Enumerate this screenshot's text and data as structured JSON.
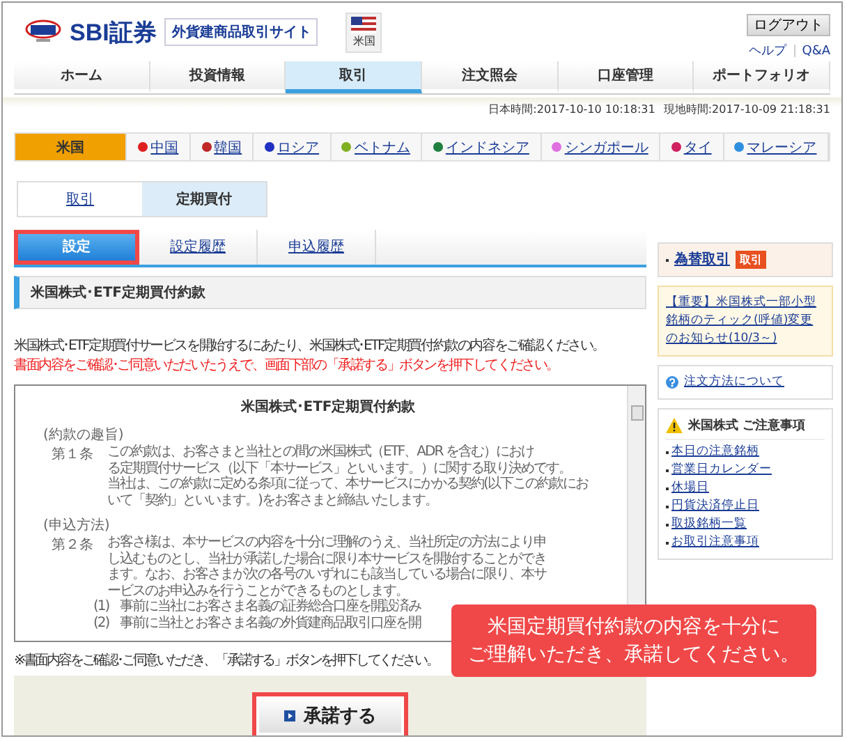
{
  "header": {
    "logo_text": "SBI証券",
    "site_name": "外貨建商品取引サイト",
    "flag_label": "米国",
    "logout": "ログアウト",
    "links": [
      "ヘルプ",
      "Q&A"
    ]
  },
  "nav": [
    {
      "label": "ホーム",
      "selected": false
    },
    {
      "label": "投資情報",
      "selected": false
    },
    {
      "label": "取引",
      "selected": true
    },
    {
      "label": "注文照会",
      "selected": false
    },
    {
      "label": "口座管理",
      "selected": false
    },
    {
      "label": "ポートフォリオ",
      "selected": false
    }
  ],
  "times": [
    "日本時間:2017-10-10 10:18:31",
    "現地時間:2017-10-09 21:18:31"
  ],
  "countries": [
    {
      "label": "米国",
      "selected": true,
      "color": "#f0a000"
    },
    {
      "label": "中国",
      "selected": false,
      "color": "#e02020"
    },
    {
      "label": "韓国",
      "selected": false,
      "color": "#c02828"
    },
    {
      "label": "ロシア",
      "selected": false,
      "color": "#2030c0"
    },
    {
      "label": "ベトナム",
      "selected": false,
      "color": "#80b020"
    },
    {
      "label": "インドネシア",
      "selected": false,
      "color": "#208040"
    },
    {
      "label": "シンガポール",
      "selected": false,
      "color": "#e070e0"
    },
    {
      "label": "タイ",
      "selected": false,
      "color": "#d02060"
    },
    {
      "label": "マレーシア",
      "selected": false,
      "color": "#3090e0"
    }
  ],
  "mode_tabs": [
    {
      "label": "取引",
      "selected": false
    },
    {
      "label": "定期買付",
      "selected": true
    }
  ],
  "sub_tabs": [
    {
      "label": "設定",
      "selected": true,
      "highlighted": true
    },
    {
      "label": "設定履歴",
      "selected": false,
      "highlighted": false
    },
    {
      "label": "申込履歴",
      "selected": false,
      "highlighted": false
    }
  ],
  "section_title": "米国株式･ETF定期買付約款",
  "intro": [
    {
      "kind": "normal",
      "text": "米国株式･ETF定期買付サービスを開始するにあたり、米国株式･ETF定期買付約款の内容をご確認ください。"
    },
    {
      "kind": "warning",
      "text": "書面内容をご確認･ご同意いただいたうえで、画面下部の「承諾する」ボタンを押下してください。"
    }
  ],
  "document": {
    "title": "米国株式･ETF定期買付約款",
    "articles": [
      {
        "heading": "(約款の趣旨)",
        "number": "第１条",
        "lines": [
          "この約款は、お客さまと当社との間の米国株式（ETF、ADR を含む）におけ",
          "る定期買付サービス（以下「本サービス」といいます。）に関する取り決めです。",
          "当社は、この約款に定める条項に従って、本サービスにかかる契約(以下この約款にお",
          "いて「契約」といいます。)をお客さまと締結いたします。"
        ]
      },
      {
        "heading": "(申込方法)",
        "number": "第２条",
        "lines": [
          "お客さ様は、本サービスの内容を十分に理解のうえ、当社所定の方法により申",
          "し込むものとし、当社が承諾した場合に限り本サービスを開始することができ",
          "ます。なお、お客さまが次の各号のいずれにも該当している場合に限り、本サ",
          "ービスのお申込みを行うことができるものとします。"
        ],
        "items": [
          {
            "number": "(1)",
            "text": "事前に当社にお客さま名義の証券総合口座を開設済み"
          },
          {
            "number": "(2)",
            "text": "事前に当社とお客さま名義の外貨建商品取引口座を開"
          }
        ]
      }
    ]
  },
  "note": "※書面内容をご確認･ご同意いただき、「承諾する」ボタンを押下してください。",
  "accept_button": {
    "label": "承諾する",
    "highlighted": true
  },
  "callout": [
    "米国定期買付約款の内容を十分に",
    "ご理解いただき、承諾してください。"
  ],
  "sidebar": {
    "fx_label": "為替取引",
    "fx_badge": "取引",
    "notice": "【重要】米国株式一部小型銘柄のティック(呼値)変更のお知らせ(10/3～)",
    "order_method": "注文方法について",
    "cautions_title": "米国株式 ご注意事項",
    "cautions": [
      "本日の注意銘柄",
      "営業日カレンダー",
      "休場日",
      "円貨決済停止日",
      "取扱銘柄一覧",
      "お取引注意事項"
    ]
  }
}
